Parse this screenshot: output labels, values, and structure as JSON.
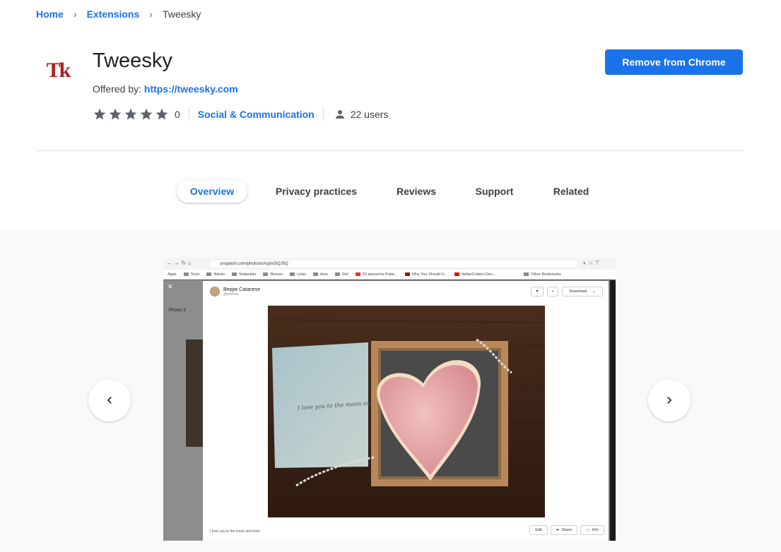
{
  "breadcrumb": {
    "home": "Home",
    "extensions": "Extensions",
    "current": "Tweesky",
    "separator": "›"
  },
  "extension": {
    "logo_text": "Tk",
    "title": "Tweesky",
    "offered_by_label": "Offered by:",
    "offered_by_link": "https://tweesky.com",
    "rating_count": "0",
    "category": "Social & Communication",
    "users": "22 users",
    "remove_button": "Remove from Chrome"
  },
  "tabs": [
    {
      "label": "Overview",
      "active": true
    },
    {
      "label": "Privacy practices",
      "active": false
    },
    {
      "label": "Reviews",
      "active": false
    },
    {
      "label": "Support",
      "active": false
    },
    {
      "label": "Related",
      "active": false
    }
  ],
  "screenshot": {
    "url": "unsplash.com/photos/oXypInSQJ5Q",
    "bookmarks": [
      "Apps",
      "Tools",
      "Admin",
      "Sebastian",
      "Romeo",
      "Links",
      "Ams",
      "Ref",
      "10 awesome Kube...",
      "Why You Should U...",
      "ItalianCoders Dev...",
      "Other Bookmarks"
    ],
    "side_label": "Photos 3",
    "author_name": "Beppe Catanese",
    "author_handle": "@perlosa",
    "download_label": "Download",
    "caption": "I love you to the moon and back",
    "card_text": "I love you to the moon and back",
    "footer_buttons": [
      "Edit",
      "Share",
      "Info"
    ]
  },
  "colors": {
    "accent": "#1a73e8",
    "logo_red": "#b11f24",
    "gallery_bg": "#f8f9fa"
  }
}
